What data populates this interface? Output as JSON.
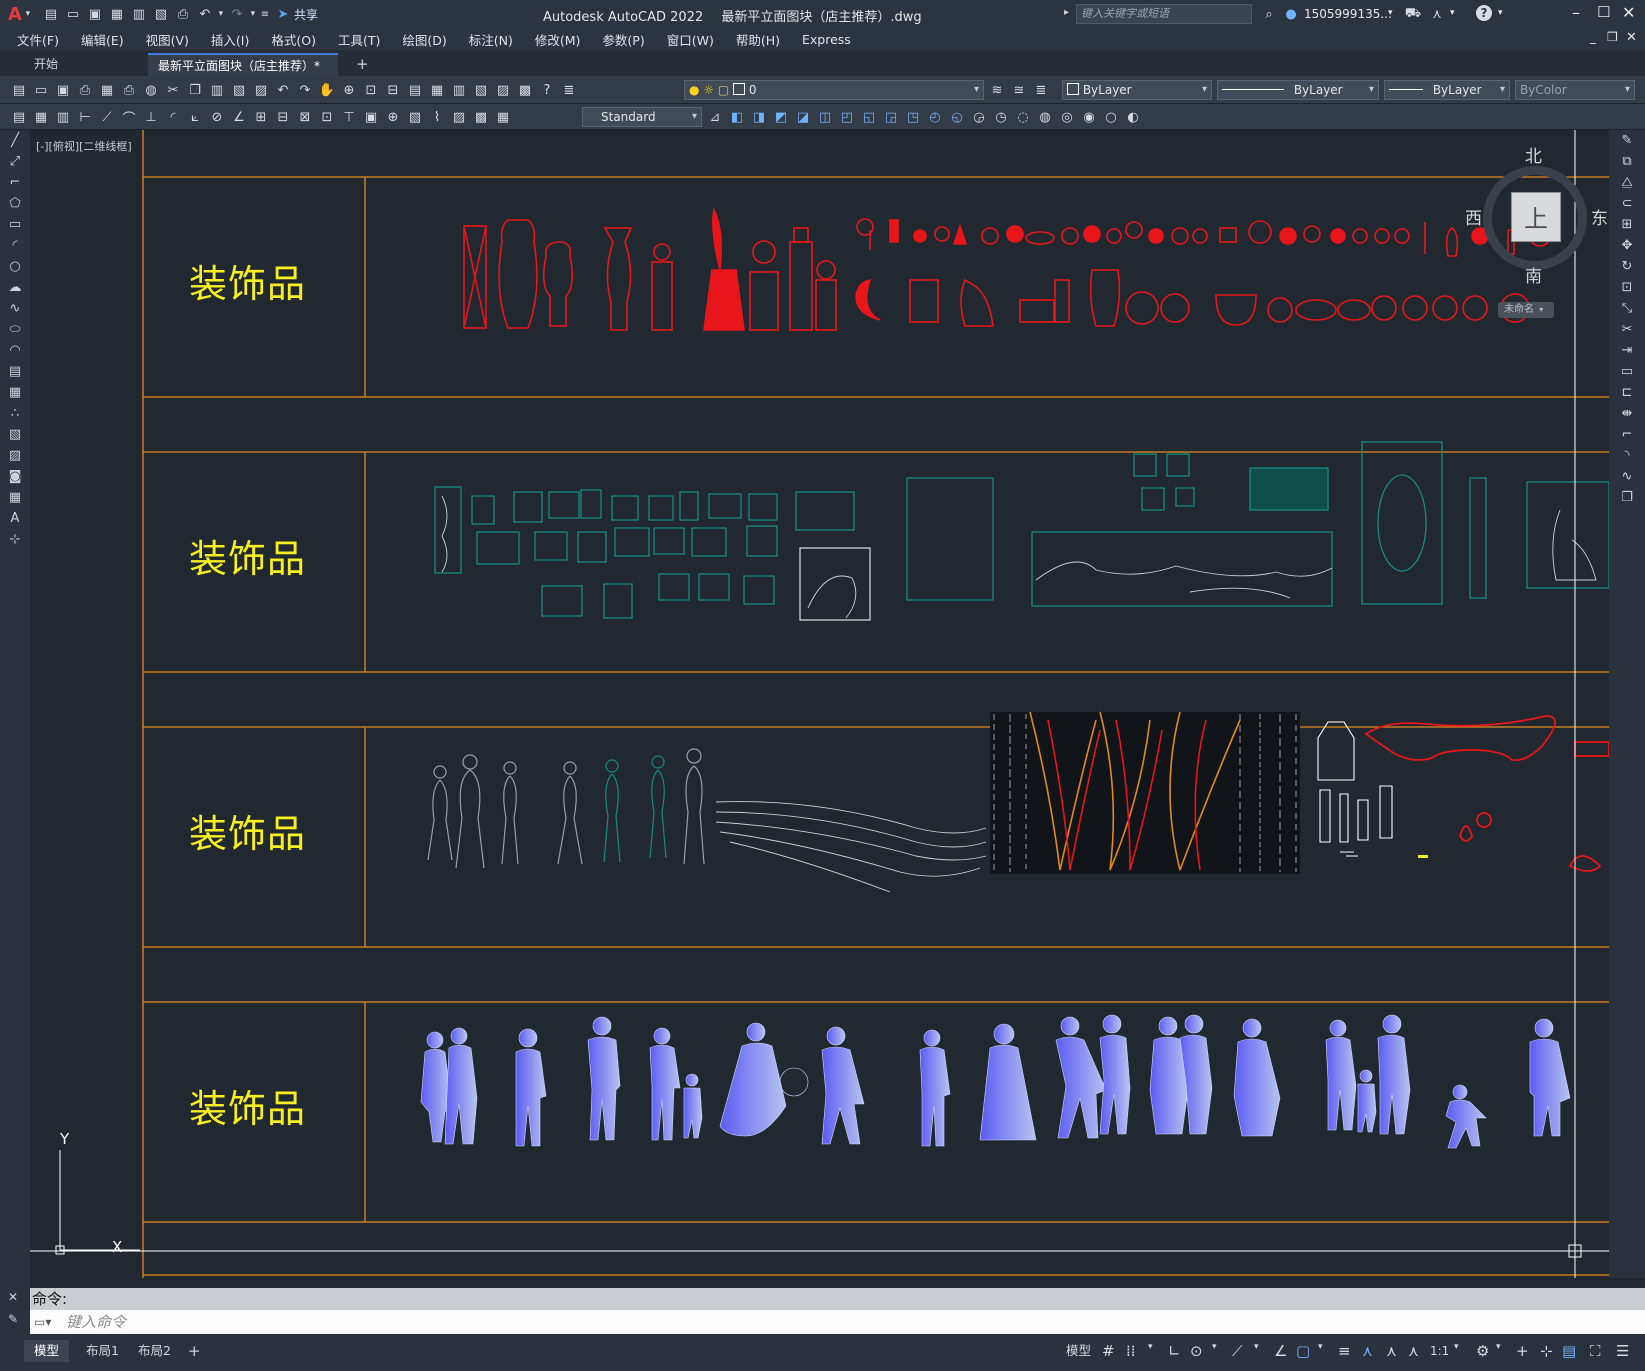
{
  "title": {
    "app": "Autodesk AutoCAD 2022",
    "file": "最新平立面图块（店主推荐）.dwg",
    "share": "共享",
    "search_placeholder": "键入关键字或短语",
    "user": "1505999135...",
    "help": "?"
  },
  "menu": [
    "文件(F)",
    "编辑(E)",
    "视图(V)",
    "插入(I)",
    "格式(O)",
    "工具(T)",
    "绘图(D)",
    "标注(N)",
    "修改(M)",
    "参数(P)",
    "窗口(W)",
    "帮助(H)",
    "Express"
  ],
  "tabs": {
    "start": "开始",
    "active": "最新平立面图块（店主推荐）*",
    "close": "✕",
    "add": "+"
  },
  "toolbar": {
    "layer_value": "0",
    "color": "ByLayer",
    "linetype": "ByLayer",
    "lineweight": "ByLayer",
    "plotstyle": "ByColor",
    "textstyle": "Standard"
  },
  "viewport": {
    "label": "[-][俯视][二维线框]"
  },
  "viewcube": {
    "north": "北",
    "south": "南",
    "east": "东",
    "west": "西",
    "top": "上",
    "ucs": "未命名"
  },
  "drawing": {
    "rows": [
      {
        "label": "装饰品",
        "content": "red-vases-sculptures"
      },
      {
        "label": "装饰品",
        "content": "framed-paintings"
      },
      {
        "label": "装饰品",
        "content": "people-sketches-trees"
      },
      {
        "label": "装饰品",
        "content": "blue-people-silhouettes"
      }
    ],
    "colors": {
      "frame": "#e38a1e",
      "label": "#f7f020",
      "red": "#e8161a",
      "teal": "#178a82",
      "gray": "#9aa0a6",
      "blue": "#5b5cf2"
    }
  },
  "ucs": {
    "y": "Y",
    "x": "X"
  },
  "command": {
    "history": "命令:",
    "placeholder": "键入命令"
  },
  "status": {
    "tabs": [
      "模型",
      "布局1",
      "布局2"
    ],
    "add": "+",
    "model_button": "模型",
    "scale": "1:1"
  }
}
